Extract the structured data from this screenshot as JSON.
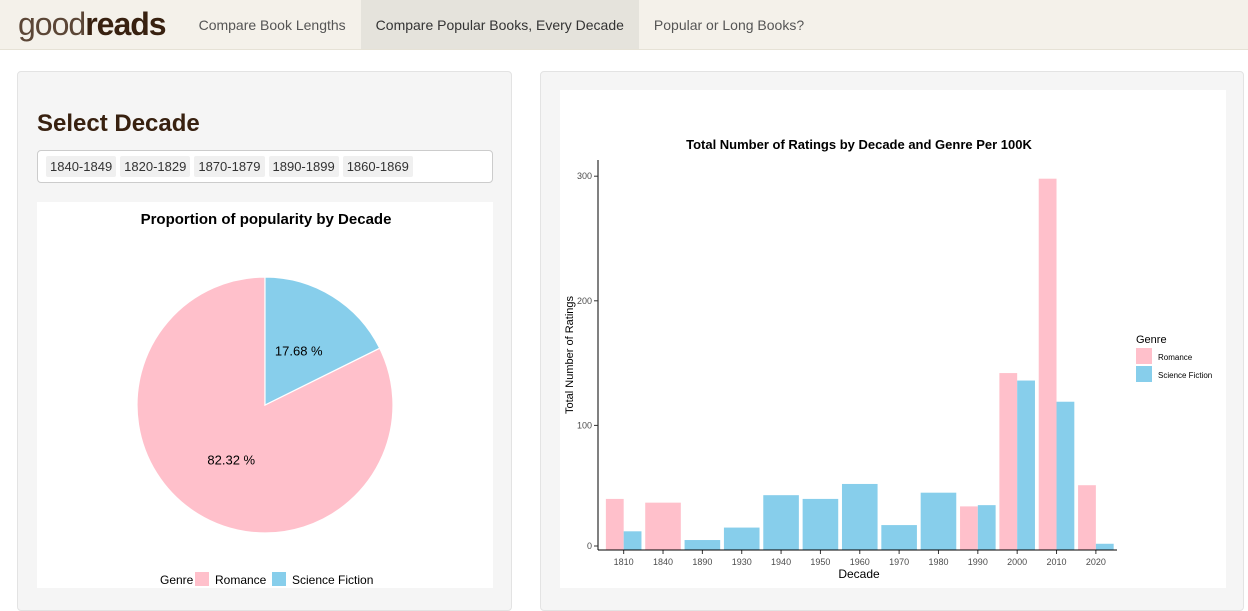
{
  "navbar": {
    "brand_light": "good",
    "brand_bold": "reads",
    "tabs": [
      {
        "label": "Compare Book Lengths",
        "active": false
      },
      {
        "label": "Compare Popular Books, Every Decade",
        "active": true
      },
      {
        "label": "Popular or Long Books?",
        "active": false
      }
    ]
  },
  "left_panel": {
    "title": "Select Decade",
    "selected_decades": [
      "1840-1849",
      "1820-1829",
      "1870-1879",
      "1890-1899",
      "1860-1869"
    ]
  },
  "colors": {
    "romance": "#ffc0cb",
    "science_fiction": "#87ceeb"
  },
  "chart_data": [
    {
      "type": "pie",
      "title": "Proportion of popularity by Decade",
      "slices": [
        {
          "name": "Romance",
          "value": 82.32,
          "label": "82.32 %"
        },
        {
          "name": "Science Fiction",
          "value": 17.68,
          "label": "17.68 %"
        }
      ],
      "legend": {
        "title": "Genre",
        "position": "bottom",
        "items": [
          "Romance",
          "Science Fiction"
        ]
      }
    },
    {
      "type": "bar",
      "title": "Total Number of Ratings by Decade and Genre Per 100K",
      "xlabel": "Decade",
      "ylabel": "Total Number of Ratings",
      "categories": [
        "1810",
        "1840",
        "1890",
        "1930",
        "1940",
        "1950",
        "1960",
        "1970",
        "1980",
        "1990",
        "2000",
        "2010",
        "2020"
      ],
      "series": [
        {
          "name": "Romance",
          "values": [
            41,
            38,
            null,
            null,
            null,
            null,
            null,
            null,
            null,
            35,
            142,
            298,
            52
          ]
        },
        {
          "name": "Science Fiction",
          "values": [
            15,
            null,
            8,
            18,
            44,
            41,
            53,
            20,
            46,
            36,
            136,
            119,
            5
          ]
        }
      ],
      "ylim": [
        0,
        313
      ],
      "yticks": [
        0,
        100,
        200,
        300
      ],
      "grid": false,
      "legend": {
        "title": "Genre",
        "position": "right",
        "items": [
          "Romance",
          "Science Fiction"
        ]
      }
    }
  ]
}
